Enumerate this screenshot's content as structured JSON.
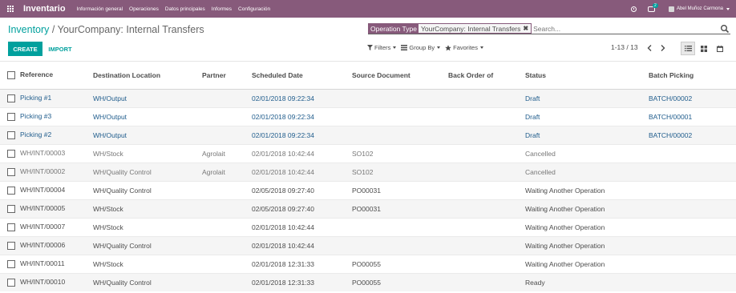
{
  "navbar": {
    "app_name": "Inventario",
    "menu": [
      "Información general",
      "Operaciones",
      "Datos principales",
      "Informes",
      "Configuración"
    ],
    "chat_badge": "2",
    "user_name": "Abel Muñoz Carmona"
  },
  "breadcrumb": {
    "parent": "Inventory",
    "separator": "/",
    "current": "YourCompany: Internal Transfers"
  },
  "search": {
    "facet_label": "Operation Type",
    "facet_value": "YourCompany: Internal Transfers",
    "facet_close": "✖",
    "placeholder": "Search..."
  },
  "buttons": {
    "create": "CREATE",
    "import": "IMPORT",
    "filters": "Filters",
    "group_by": "Group By",
    "favorites": "Favorites"
  },
  "pager": {
    "value": "1-13 / 13"
  },
  "table": {
    "columns": [
      "Reference",
      "Destination Location",
      "Partner",
      "Scheduled Date",
      "Source Document",
      "Back Order of",
      "Status",
      "Batch Picking"
    ],
    "rows": [
      {
        "reference": "Picking #1",
        "destination": "WH/Output",
        "partner": "",
        "scheduled": "02/01/2018 09:22:34",
        "source": "",
        "backorder": "",
        "status": "Draft",
        "batch": "BATCH/00002"
      },
      {
        "reference": "Picking #3",
        "destination": "WH/Output",
        "partner": "",
        "scheduled": "02/01/2018 09:22:34",
        "source": "",
        "backorder": "",
        "status": "Draft",
        "batch": "BATCH/00001"
      },
      {
        "reference": "Picking #2",
        "destination": "WH/Output",
        "partner": "",
        "scheduled": "02/01/2018 09:22:34",
        "source": "",
        "backorder": "",
        "status": "Draft",
        "batch": "BATCH/00002"
      },
      {
        "reference": "WH/INT/00003",
        "destination": "WH/Stock",
        "partner": "Agrolait",
        "scheduled": "02/01/2018 10:42:44",
        "source": "SO102",
        "backorder": "",
        "status": "Cancelled",
        "batch": ""
      },
      {
        "reference": "WH/INT/00002",
        "destination": "WH/Quality Control",
        "partner": "Agrolait",
        "scheduled": "02/01/2018 10:42:44",
        "source": "SO102",
        "backorder": "",
        "status": "Cancelled",
        "batch": ""
      },
      {
        "reference": "WH/INT/00004",
        "destination": "WH/Quality Control",
        "partner": "",
        "scheduled": "02/05/2018 09:27:40",
        "source": "PO00031",
        "backorder": "",
        "status": "Waiting Another Operation",
        "batch": ""
      },
      {
        "reference": "WH/INT/00005",
        "destination": "WH/Stock",
        "partner": "",
        "scheduled": "02/05/2018 09:27:40",
        "source": "PO00031",
        "backorder": "",
        "status": "Waiting Another Operation",
        "batch": ""
      },
      {
        "reference": "WH/INT/00007",
        "destination": "WH/Stock",
        "partner": "",
        "scheduled": "02/01/2018 10:42:44",
        "source": "",
        "backorder": "",
        "status": "Waiting Another Operation",
        "batch": ""
      },
      {
        "reference": "WH/INT/00006",
        "destination": "WH/Quality Control",
        "partner": "",
        "scheduled": "02/01/2018 10:42:44",
        "source": "",
        "backorder": "",
        "status": "Waiting Another Operation",
        "batch": ""
      },
      {
        "reference": "WH/INT/00011",
        "destination": "WH/Stock",
        "partner": "",
        "scheduled": "02/01/2018 12:31:33",
        "source": "PO00055",
        "backorder": "",
        "status": "Waiting Another Operation",
        "batch": ""
      },
      {
        "reference": "WH/INT/00010",
        "destination": "WH/Quality Control",
        "partner": "",
        "scheduled": "02/01/2018 12:31:33",
        "source": "PO00055",
        "backorder": "",
        "status": "Ready",
        "batch": ""
      }
    ]
  }
}
